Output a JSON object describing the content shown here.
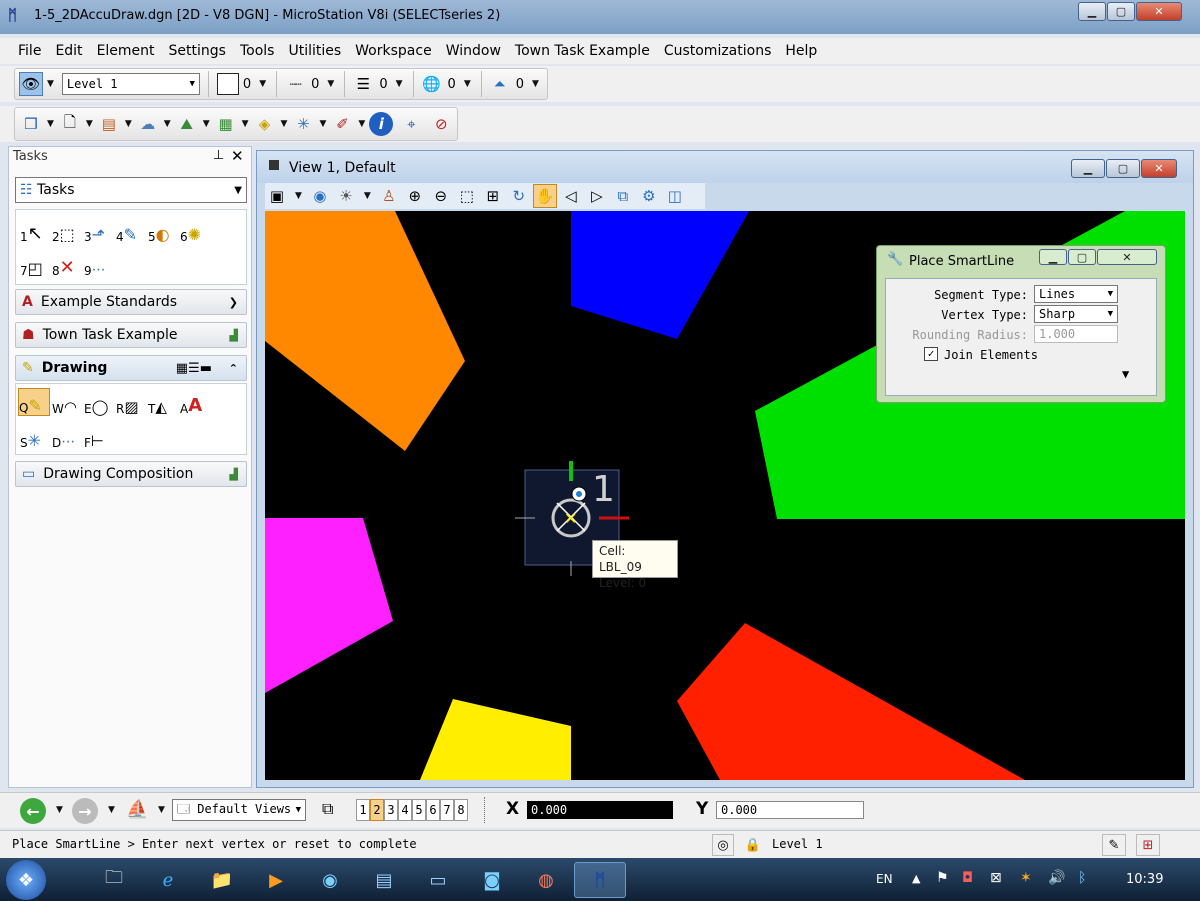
{
  "window": {
    "title": "1-5_2DAccuDraw.dgn [2D - V8 DGN] - MicroStation V8i (SELECTseries 2)"
  },
  "menu": [
    "File",
    "Edit",
    "Element",
    "Settings",
    "Tools",
    "Utilities",
    "Workspace",
    "Window",
    "Town Task Example",
    "Customizations",
    "Help"
  ],
  "attributes": {
    "level": "Level 1",
    "color": "0",
    "style": "0",
    "weight": "0",
    "transparency": "0",
    "priority": "0"
  },
  "tasks": {
    "title": "Tasks",
    "dropdown": "Tasks",
    "main_tools": [
      "1",
      "2",
      "3",
      "4",
      "5",
      "6",
      "7",
      "8",
      "9"
    ],
    "sections": [
      "Example Standards",
      "Town Task Example",
      "Drawing",
      "Drawing Composition"
    ],
    "drawing_tools": [
      "Q",
      "W",
      "E",
      "R",
      "T",
      "A",
      "S",
      "D",
      "F"
    ]
  },
  "view": {
    "title": "View 1, Default"
  },
  "tooltip": {
    "cell": "Cell: LBL_09",
    "level": "Level: 0"
  },
  "accudraw_index": "1",
  "smartline": {
    "title": "Place SmartLine",
    "segment_type_label": "Segment Type:",
    "segment_type": "Lines",
    "vertex_type_label": "Vertex Type:",
    "vertex_type": "Sharp",
    "rounding_radius_label": "Rounding Radius:",
    "rounding_radius": "1.000",
    "join_label": "Join Elements"
  },
  "viewbar": {
    "saved_views": "Default Views",
    "views": [
      "1",
      "2",
      "3",
      "4",
      "5",
      "6",
      "7",
      "8"
    ],
    "x_label": "X",
    "x_value": "0.000",
    "y_label": "Y",
    "y_value": "0.000"
  },
  "status": {
    "prompt": "Place SmartLine > Enter next vertex or reset to complete",
    "level": "Level 1"
  },
  "taskbar": {
    "lang": "EN",
    "time": "10:39"
  },
  "colors": {
    "orange": "#ff8800",
    "blue": "#0000ff",
    "green": "#00e000",
    "magenta": "#ff20ff",
    "red": "#ff2000",
    "yellow": "#ffee00"
  }
}
